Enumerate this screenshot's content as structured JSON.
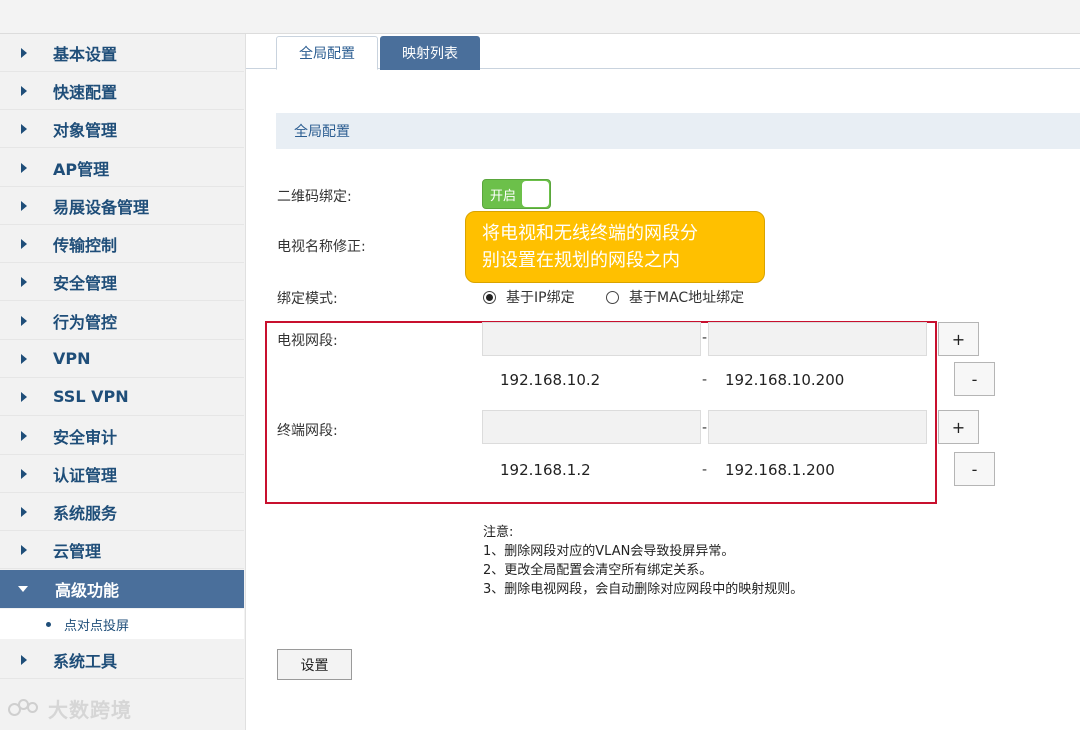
{
  "sidebar": {
    "items": [
      {
        "label": "基本设置"
      },
      {
        "label": "快速配置"
      },
      {
        "label": "对象管理"
      },
      {
        "label": "AP管理"
      },
      {
        "label": "易展设备管理"
      },
      {
        "label": "传输控制"
      },
      {
        "label": "安全管理"
      },
      {
        "label": "行为管控"
      },
      {
        "label": "VPN"
      },
      {
        "label": "SSL VPN"
      },
      {
        "label": "安全审计"
      },
      {
        "label": "认证管理"
      },
      {
        "label": "系统服务"
      },
      {
        "label": "云管理"
      },
      {
        "label": "高级功能",
        "active": true
      },
      {
        "label": "系统工具"
      }
    ],
    "sub_item": {
      "label": "点对点投屏"
    }
  },
  "watermark": {
    "text": "大数跨境"
  },
  "tabs": [
    {
      "label": "全局配置",
      "active": true
    },
    {
      "label": "映射列表",
      "active": false
    }
  ],
  "section": {
    "title": "全局配置"
  },
  "form": {
    "qr_bind_label": "二维码绑定:",
    "toggle_label": "开启",
    "toggle_on": true,
    "tv_name_label": "电视名称修正:",
    "bind_mode_label": "绑定模式:",
    "bind_mode_options": [
      {
        "label": "基于IP绑定",
        "selected": true
      },
      {
        "label": "基于MAC地址绑定",
        "selected": false
      }
    ],
    "tv_segment_label": "电视网段:",
    "tv_segment": {
      "start": "192.168.10.2",
      "end": "192.168.10.200"
    },
    "terminal_segment_label": "终端网段:",
    "terminal_segment": {
      "start": "192.168.1.2",
      "end": "192.168.1.200"
    },
    "dash": "-",
    "add_label": "+",
    "remove_label": "-"
  },
  "callout": {
    "line1": "将电视和无线终端的网段分",
    "line2": "别设置在规划的网段之内"
  },
  "notes": {
    "title": "注意:",
    "lines": [
      "1、删除网段对应的VLAN会导致投屏异常。",
      "2、更改全局配置会清空所有绑定关系。",
      "3、删除电视网段，会自动删除对应网段中的映射规则。"
    ]
  },
  "submit_label": "设置",
  "colors": {
    "nav_text": "#1f4e79",
    "nav_active_bg": "#4a6f9b",
    "toggle_on": "#6cc04a",
    "callout": "#ffc000",
    "highlight_box": "#c8102e"
  }
}
